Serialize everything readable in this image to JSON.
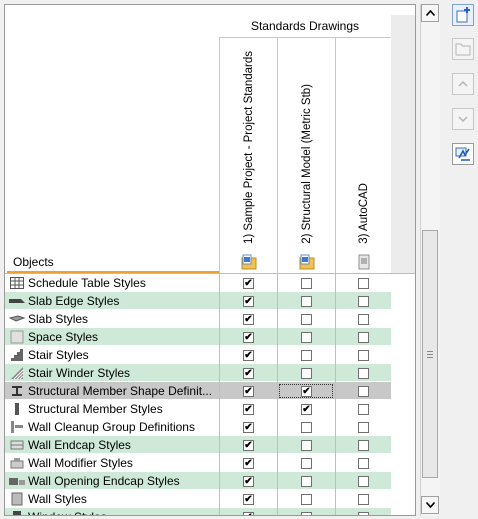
{
  "header": {
    "group_title": "Standards Drawings",
    "objects_label": "Objects",
    "columns": [
      {
        "label": "1) Sample Project - Project Standards",
        "icon": "folder-drawing-icon"
      },
      {
        "label": "2) Structural Model (Metric Stb)",
        "icon": "folder-drawing-icon"
      },
      {
        "label": "3) AutoCAD",
        "icon": "drawing-file-icon"
      }
    ]
  },
  "rows": [
    {
      "name": "Schedule Table Styles",
      "icon": "schedule-table-icon",
      "checks": [
        true,
        false,
        false
      ],
      "color": "white"
    },
    {
      "name": "Slab Edge Styles",
      "icon": "slab-edge-icon",
      "checks": [
        true,
        false,
        false
      ],
      "color": "green"
    },
    {
      "name": "Slab Styles",
      "icon": "slab-icon",
      "checks": [
        true,
        false,
        false
      ],
      "color": "white"
    },
    {
      "name": "Space Styles",
      "icon": "space-icon",
      "checks": [
        true,
        false,
        false
      ],
      "color": "green"
    },
    {
      "name": "Stair Styles",
      "icon": "stair-icon",
      "checks": [
        true,
        false,
        false
      ],
      "color": "white"
    },
    {
      "name": "Stair Winder Styles",
      "icon": "stair-winder-icon",
      "checks": [
        true,
        false,
        false
      ],
      "color": "green"
    },
    {
      "name": "Structural Member Shape Definit...",
      "icon": "member-shape-icon",
      "checks": [
        true,
        true,
        false
      ],
      "color": "sel"
    },
    {
      "name": "Structural Member Styles",
      "icon": "member-style-icon",
      "checks": [
        true,
        true,
        false
      ],
      "color": "white"
    },
    {
      "name": "Wall Cleanup Group Definitions",
      "icon": "wall-cleanup-icon",
      "checks": [
        true,
        false,
        false
      ],
      "color": "white"
    },
    {
      "name": "Wall Endcap Styles",
      "icon": "wall-endcap-icon",
      "checks": [
        true,
        false,
        false
      ],
      "color": "green"
    },
    {
      "name": "Wall Modifier Styles",
      "icon": "wall-modifier-icon",
      "checks": [
        true,
        false,
        false
      ],
      "color": "white"
    },
    {
      "name": "Wall Opening Endcap Styles",
      "icon": "wall-opening-endcap-icon",
      "checks": [
        true,
        false,
        false
      ],
      "color": "green"
    },
    {
      "name": "Wall Styles",
      "icon": "wall-style-icon",
      "checks": [
        true,
        false,
        false
      ],
      "color": "white"
    },
    {
      "name": "Window Styles",
      "icon": "window-style-icon",
      "checks": [
        true,
        false,
        false
      ],
      "color": "green"
    }
  ],
  "toolbar": [
    {
      "name": "add-drawing-button",
      "icon": "add-drawing-icon",
      "state": "active"
    },
    {
      "name": "open-folder-button",
      "icon": "folder-icon",
      "state": "disabled"
    },
    {
      "name": "move-up-button",
      "icon": "chevron-up-icon",
      "state": "disabled"
    },
    {
      "name": "move-down-button",
      "icon": "chevron-down-icon",
      "state": "disabled"
    },
    {
      "name": "sync-standards-button",
      "icon": "sync-icon",
      "state": "normal"
    }
  ],
  "colors": {
    "green_row": "#cfe9d9",
    "selected_row": "#c8c8c8",
    "accent_line": "#f0a030"
  }
}
